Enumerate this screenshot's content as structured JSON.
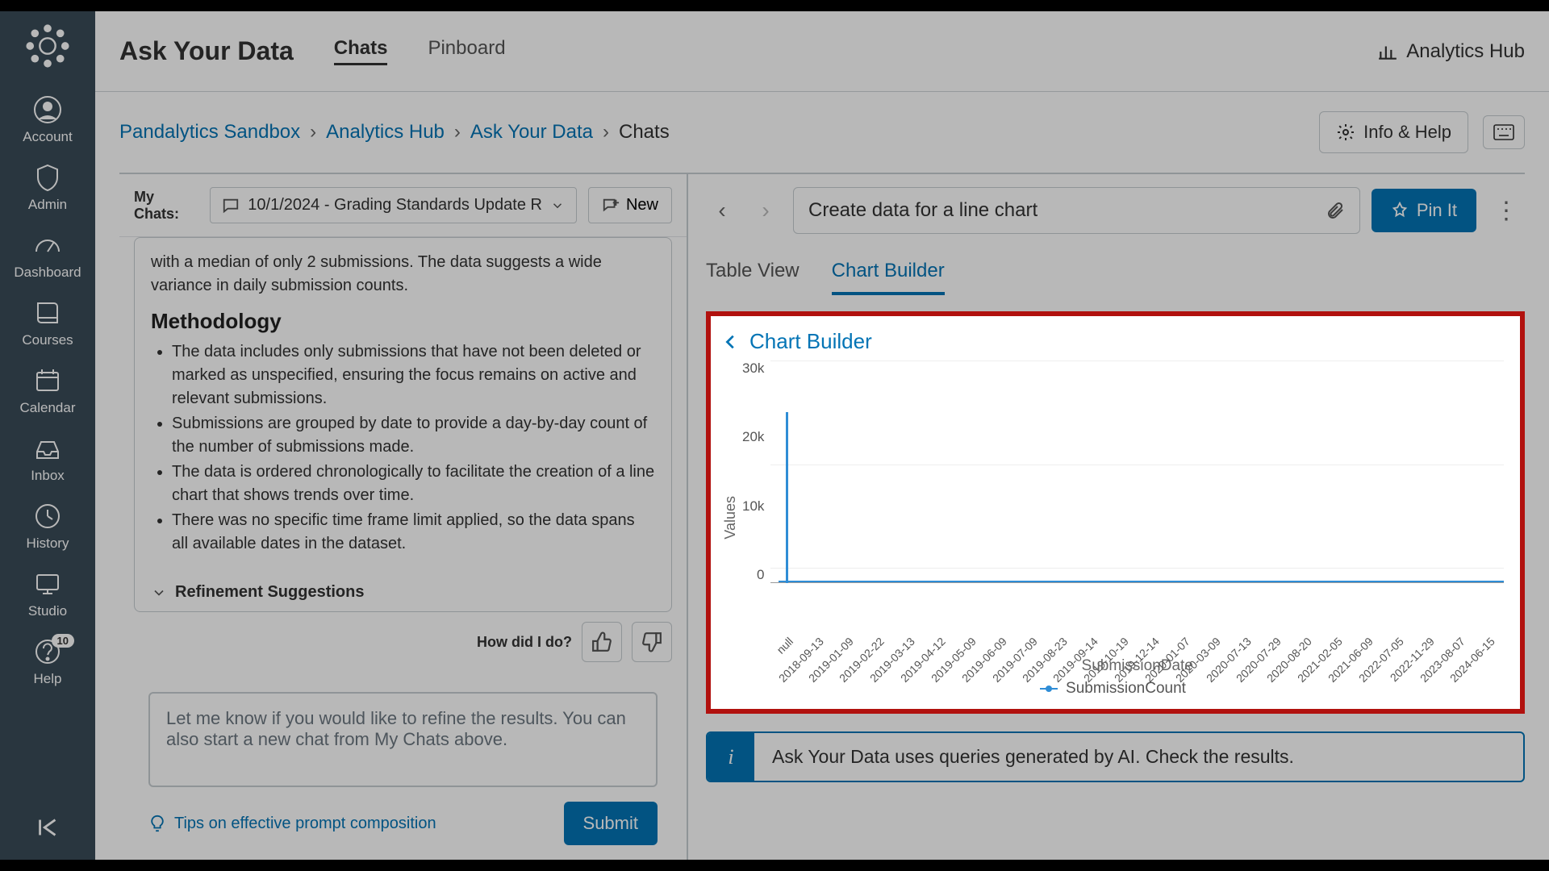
{
  "sidebar": {
    "items": [
      {
        "label": "Account"
      },
      {
        "label": "Admin"
      },
      {
        "label": "Dashboard"
      },
      {
        "label": "Courses"
      },
      {
        "label": "Calendar"
      },
      {
        "label": "Inbox"
      },
      {
        "label": "History"
      },
      {
        "label": "Studio"
      },
      {
        "label": "Help",
        "badge": "10"
      }
    ]
  },
  "topbar": {
    "title": "Ask Your Data",
    "tabs": {
      "chats": "Chats",
      "pinboard": "Pinboard"
    },
    "analytics_hub": "Analytics Hub"
  },
  "breadcrumb": {
    "items": [
      "Pandalytics Sandbox",
      "Analytics Hub",
      "Ask Your Data",
      "Chats"
    ]
  },
  "info_help": "Info & Help",
  "my_chats": {
    "label": "My Chats:",
    "selected": "10/1/2024 - Grading Standards Update R",
    "new_label": "New"
  },
  "response": {
    "summary_tail": "with a median of only 2 submissions. The data suggests a wide variance in daily submission counts.",
    "methodology_heading": "Methodology",
    "bullets": [
      "The data includes only submissions that have not been deleted or marked as unspecified, ensuring the focus remains on active and relevant submissions.",
      "Submissions are grouped by date to provide a day-by-day count of the number of submissions made.",
      "The data is ordered chronologically to facilitate the creation of a line chart that shows trends over time.",
      "There was no specific time frame limit applied, so the data spans all available dates in the dataset."
    ],
    "refinement": "Refinement Suggestions"
  },
  "feedback": {
    "label": "How did I do?"
  },
  "prompt": {
    "placeholder": "Let me know if you would like to refine the results.  You can also start a new chat from My Chats above."
  },
  "tips": "Tips on effective prompt composition",
  "submit": "Submit",
  "right": {
    "query": "Create data for a line chart",
    "pin": "Pin It",
    "tabs": {
      "table": "Table View",
      "chart": "Chart Builder"
    },
    "chart_title": "Chart Builder",
    "info_banner": "Ask Your Data uses queries generated by AI. Check the results."
  },
  "chart_data": {
    "type": "line",
    "title": "",
    "xlabel": "SubmissionDate",
    "ylabel": "Values",
    "ylim": [
      0,
      30000
    ],
    "y_ticks": [
      "30k",
      "20k",
      "10k",
      "0"
    ],
    "x_tick_labels": [
      "null",
      "2018-09-13",
      "2019-01-09",
      "2019-02-22",
      "2019-03-13",
      "2019-04-12",
      "2019-05-09",
      "2019-06-09",
      "2019-07-09",
      "2019-08-23",
      "2019-09-14",
      "2019-10-19",
      "2019-12-14",
      "2020-01-07",
      "2020-03-09",
      "2020-07-13",
      "2020-07-29",
      "2020-08-20",
      "2021-02-05",
      "2021-06-09",
      "2022-07-05",
      "2022-11-29",
      "2023-08-07",
      "2024-06-15"
    ],
    "series": [
      {
        "name": "SubmissionCount",
        "x": [
          "null",
          "2018-09-13",
          "2019-01-09",
          "2019-02-22",
          "2019-03-13",
          "2019-04-12",
          "2019-05-09",
          "2019-06-09",
          "2019-07-09",
          "2019-08-23",
          "2019-09-14",
          "2019-10-19",
          "2019-12-14",
          "2020-01-07",
          "2020-03-09",
          "2020-07-13",
          "2020-07-29",
          "2020-08-20",
          "2021-02-05",
          "2021-06-09",
          "2022-07-05",
          "2022-11-29",
          "2023-08-07",
          "2024-06-15"
        ],
        "y": [
          23000,
          50,
          50,
          50,
          50,
          50,
          50,
          50,
          50,
          50,
          50,
          50,
          50,
          50,
          50,
          50,
          50,
          50,
          50,
          50,
          50,
          50,
          50,
          50
        ]
      }
    ],
    "legend": [
      "SubmissionCount"
    ]
  }
}
